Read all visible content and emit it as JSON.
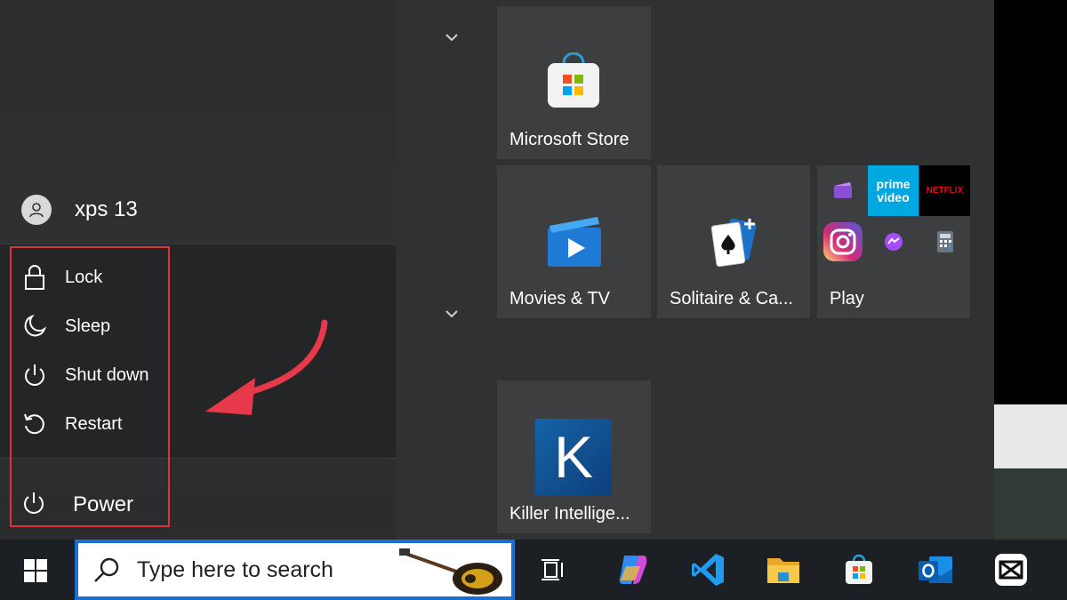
{
  "user": {
    "name": "xps 13"
  },
  "power_menu": {
    "items": [
      {
        "label": "Lock",
        "icon": "lock-icon"
      },
      {
        "label": "Sleep",
        "icon": "moon-icon"
      },
      {
        "label": "Shut down",
        "icon": "power-icon"
      },
      {
        "label": "Restart",
        "icon": "restart-icon"
      }
    ],
    "power_label": "Power"
  },
  "tiles": {
    "microsoft_store": "Microsoft Store",
    "movies_tv": "Movies & TV",
    "solitaire": "Solitaire & Ca...",
    "play": "Play",
    "killer": "Killer Intellige...",
    "killer_letter": "K",
    "prime_text": "prime video",
    "netflix_text": "NETFLIX"
  },
  "taskbar": {
    "search_placeholder": "Type here to search"
  },
  "colors": {
    "highlight": "#e0313a",
    "accent": "#1a6fd3"
  }
}
